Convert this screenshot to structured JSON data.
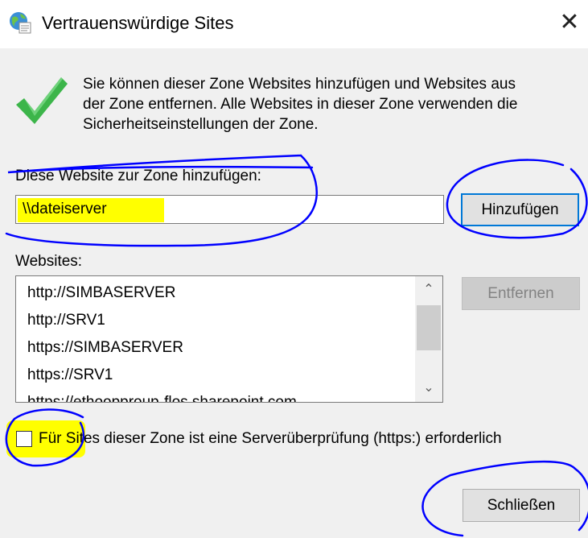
{
  "window": {
    "title": "Vertrauenswürdige Sites",
    "title_icon": "globe-icon",
    "close_glyph": "✕"
  },
  "intro": {
    "icon": "checkmark-icon",
    "text": "Sie können dieser Zone Websites hinzufügen und Websites aus\nder Zone entfernen. Alle Websites in dieser Zone verwenden die\nSicherheitseinstellungen der Zone."
  },
  "add_section": {
    "label": "Diese Website zur Zone hinzufügen:",
    "input_value": "\\\\dateiserver",
    "add_button": "Hinzufügen"
  },
  "sites_section": {
    "label": "Websites:",
    "items": [
      "http://SIMBASERVER",
      "http://SRV1",
      "https://SIMBASERVER",
      "https://SRV1",
      "https://ethoopproup-flos.sharepoint.com"
    ],
    "remove_button": "Entfernen",
    "scroll_up_glyph": "⌃",
    "scroll_down_glyph": "⌄"
  },
  "https_option": {
    "label": "Für Sites dieser Zone ist eine Serverüberprüfung (https:) erforderlich",
    "checked": false
  },
  "footer": {
    "close_button": "Schließen"
  },
  "colors": {
    "accent": "#0078d7",
    "highlight": "#ffff00",
    "annotation_pen": "#0000ff",
    "check_green": "#3cb54a"
  }
}
